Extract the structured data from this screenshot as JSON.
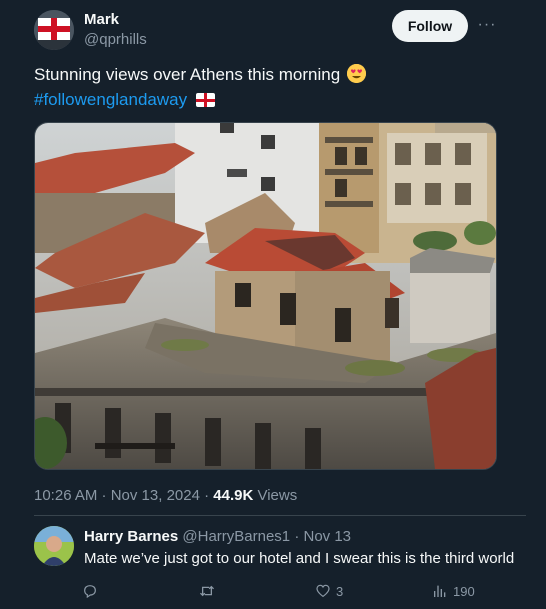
{
  "author": {
    "name": "Mark",
    "handle": "@qprhills",
    "follow_label": "Follow",
    "more_label": "···"
  },
  "tweet": {
    "text": "Stunning views over Athens this morning",
    "hashtag": "#followenglandaway",
    "timestamp": "10:26 AM · Nov 13, 2024 · ",
    "views_count": "44.9K",
    "views_label": " Views",
    "image_icon": "photo-athens-rooftops"
  },
  "reply": {
    "name": "Harry Barnes",
    "handle": "@HarryBarnes1",
    "separator": " · ",
    "date": "Nov 13",
    "text": "Mate we’ve just got to our hotel and I swear this is the third world",
    "actions": {
      "reply_count": "",
      "retweet_count": "",
      "like_count": "3",
      "views_count": "190"
    }
  },
  "colors": {
    "background": "#15202b",
    "accent": "#1d9bf0",
    "secondary_text": "#8b98a5"
  }
}
